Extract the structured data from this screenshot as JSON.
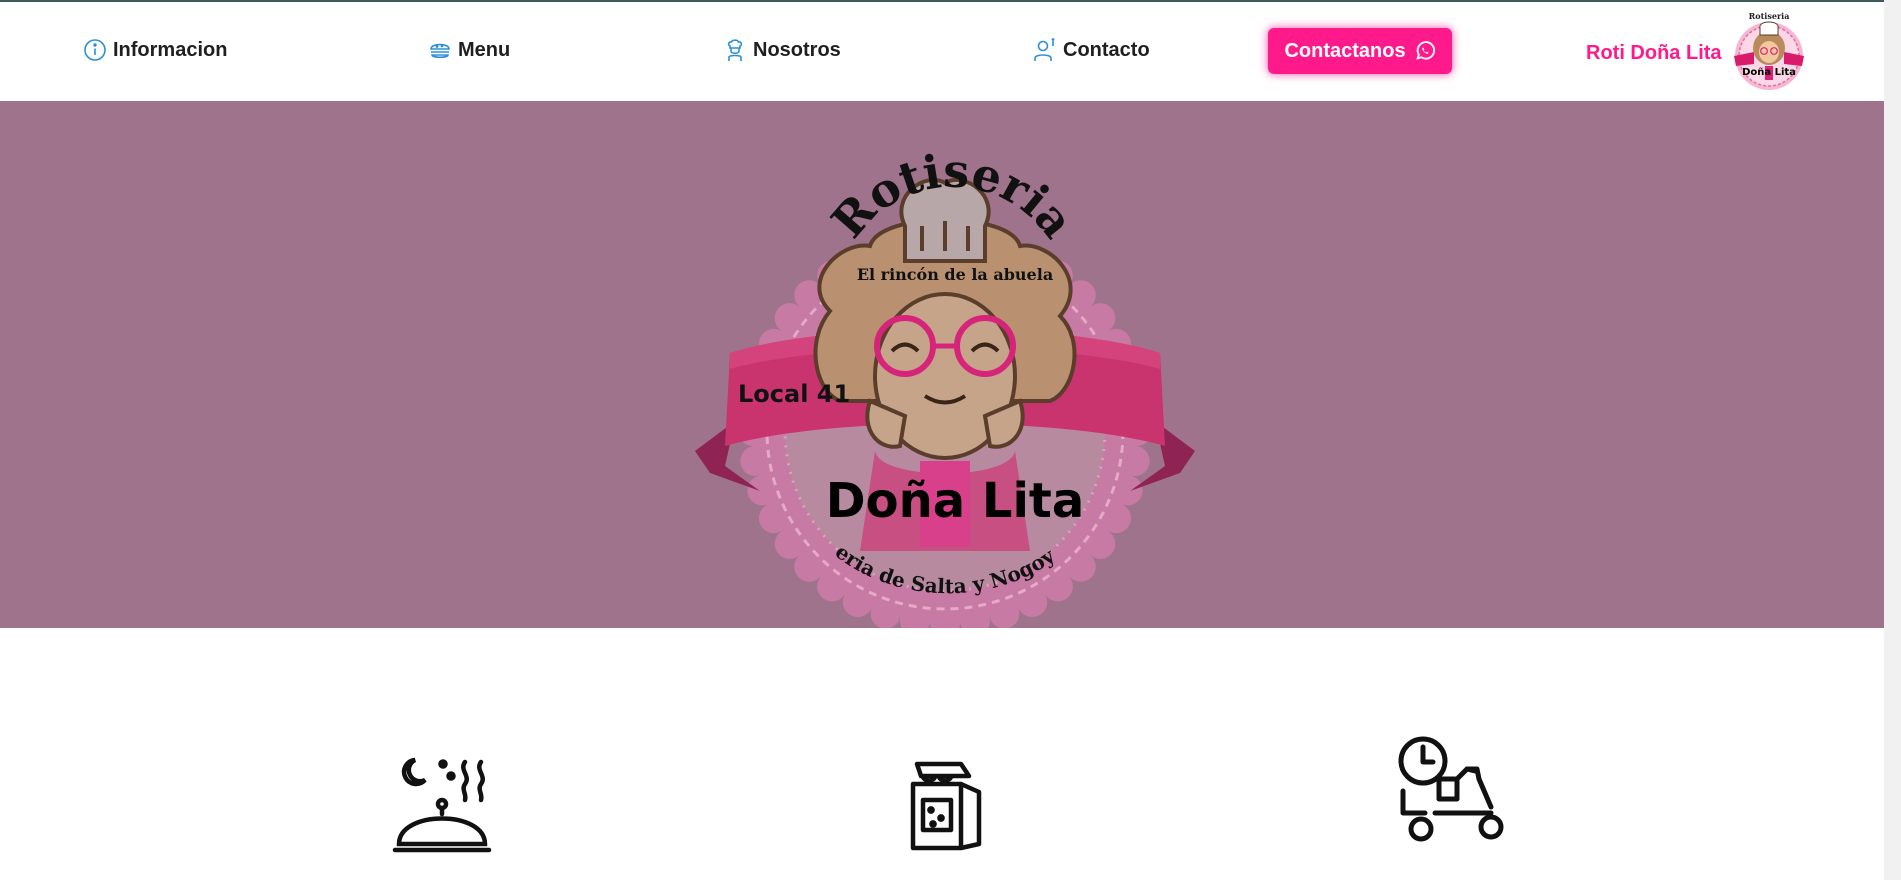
{
  "nav": {
    "items": [
      {
        "label": "Informacion",
        "icon": "info-icon"
      },
      {
        "label": "Menu",
        "icon": "burger-icon"
      },
      {
        "label": "Nosotros",
        "icon": "chef-icon"
      },
      {
        "label": "Contacto",
        "icon": "support-agent-icon"
      }
    ],
    "cta": {
      "label": "Contactanos",
      "icon": "whatsapp-icon"
    },
    "brand": {
      "label": "Roti Doña Lita",
      "logo_icon": "grandma-logo-icon"
    }
  },
  "hero": {
    "logo": {
      "top_text": "Rotiseria",
      "tagline": "El rincón de la abuela",
      "ribbon_text": "Local 41",
      "name": "Doña Lita",
      "bottom_text": "Feria de Salta y Nogoyá"
    }
  },
  "features": [
    {
      "icon": "serving-cloche-icon"
    },
    {
      "icon": "takeaway-bag-icon"
    },
    {
      "icon": "delivery-scooter-icon"
    }
  ],
  "colors": {
    "accent": "#ff1a8c",
    "hero_bg": "#a0738c",
    "nav_icon": "#2b8fd6",
    "text": "#1f1f1f"
  }
}
